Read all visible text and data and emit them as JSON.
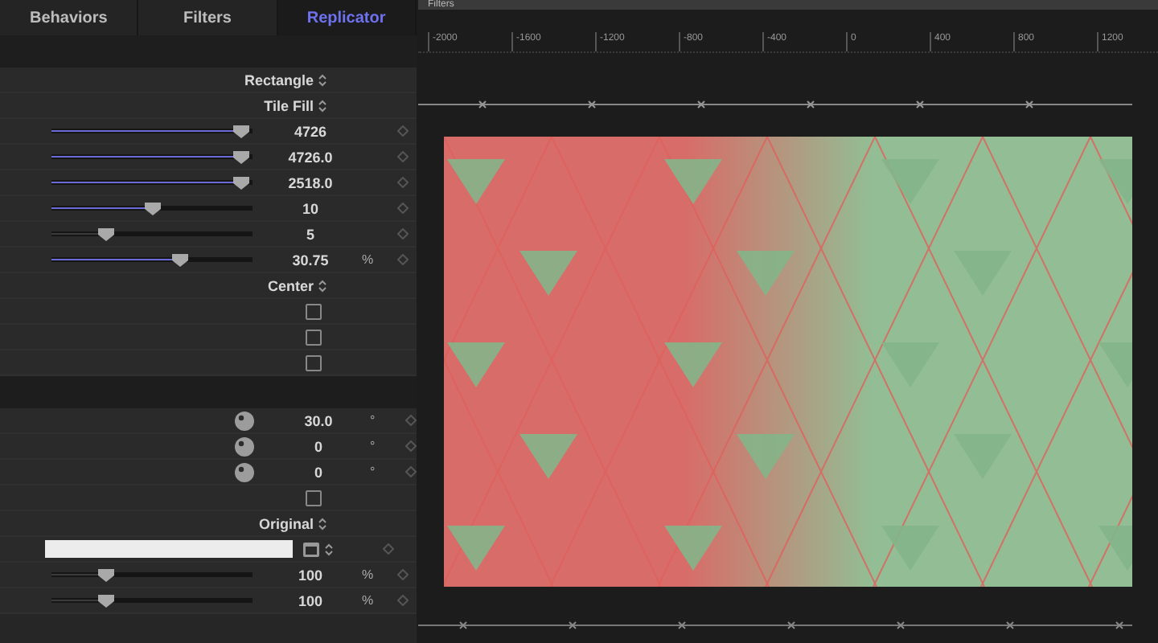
{
  "tabs": [
    {
      "label": "Behaviors",
      "selected": false
    },
    {
      "label": "Filters",
      "selected": false
    },
    {
      "label": "Replicator",
      "selected": true
    }
  ],
  "inspector_rows": [
    {
      "kind": "popup",
      "value": "Rectangle"
    },
    {
      "kind": "popup",
      "value": "Tile Fill"
    },
    {
      "kind": "slider",
      "level": 0.98,
      "highlighted": true,
      "value": "4726",
      "unit": ""
    },
    {
      "kind": "slider",
      "level": 0.98,
      "highlighted": true,
      "value": "4726.0",
      "unit": ""
    },
    {
      "kind": "slider",
      "level": 0.98,
      "highlighted": true,
      "value": "2518.0",
      "unit": ""
    },
    {
      "kind": "slider",
      "level": 0.5,
      "highlighted": true,
      "value": "10",
      "unit": ""
    },
    {
      "kind": "slider",
      "level": 0.25,
      "highlighted": false,
      "value": "5",
      "unit": ""
    },
    {
      "kind": "slider",
      "level": 0.65,
      "highlighted": true,
      "value": "30.75",
      "unit": "%"
    },
    {
      "kind": "popup",
      "value": "Center"
    },
    {
      "kind": "checkbox",
      "checked": false
    },
    {
      "kind": "checkbox",
      "checked": false
    },
    {
      "kind": "checkbox",
      "checked": false
    },
    {
      "kind": "section"
    },
    {
      "kind": "dial",
      "value": "30.0",
      "unit": "°"
    },
    {
      "kind": "dial",
      "value": "0",
      "unit": "°"
    },
    {
      "kind": "dial",
      "value": "0",
      "unit": "°"
    },
    {
      "kind": "checkbox",
      "checked": false
    },
    {
      "kind": "popup",
      "value": "Original"
    },
    {
      "kind": "color"
    },
    {
      "kind": "slider",
      "level": 0.25,
      "highlighted": false,
      "value": "100",
      "unit": "%"
    },
    {
      "kind": "slider",
      "level": 0.25,
      "highlighted": false,
      "value": "100",
      "unit": "%"
    }
  ],
  "canvas": {
    "title": "Filters",
    "ruler_labels": [
      "-2000",
      "-1600",
      "-1200",
      "-800",
      "-400",
      "0",
      "400",
      "800",
      "1200"
    ]
  }
}
